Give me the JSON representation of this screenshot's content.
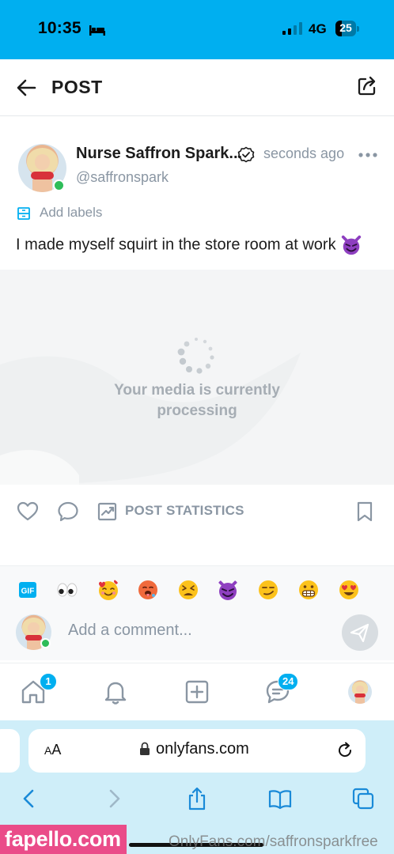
{
  "status_bar": {
    "time": "10:35",
    "network": "4G",
    "battery": "25"
  },
  "header": {
    "title": "POST"
  },
  "post": {
    "author_name": "Nurse Saffron Spark...",
    "handle": "@saffronspark",
    "time_ago": "seconds ago",
    "add_labels": "Add labels",
    "text": "I made myself squirt in the store room at work",
    "media_message_line1": "Your media is currently",
    "media_message_line2": "processing",
    "post_statistics": "POST STATISTICS"
  },
  "comment": {
    "placeholder": "Add a comment...",
    "gif_label": "GIF",
    "emojis": [
      "eyes",
      "smiling-face-with-hearts",
      "drooling-face",
      "tired-face",
      "smiling-devil",
      "smirking-face",
      "grimacing-face",
      "heart-eyes"
    ]
  },
  "nav": {
    "home_badge": "1",
    "messages_badge": "24"
  },
  "browser": {
    "aa": "AA",
    "url": "onlyfans.com"
  },
  "watermark": {
    "site": "fapello.com",
    "url": "OnlyFans.com/saffronsparkfree"
  },
  "colors": {
    "brand": "#00aff0",
    "muted": "#8a96a3",
    "online": "#2ebd59"
  }
}
